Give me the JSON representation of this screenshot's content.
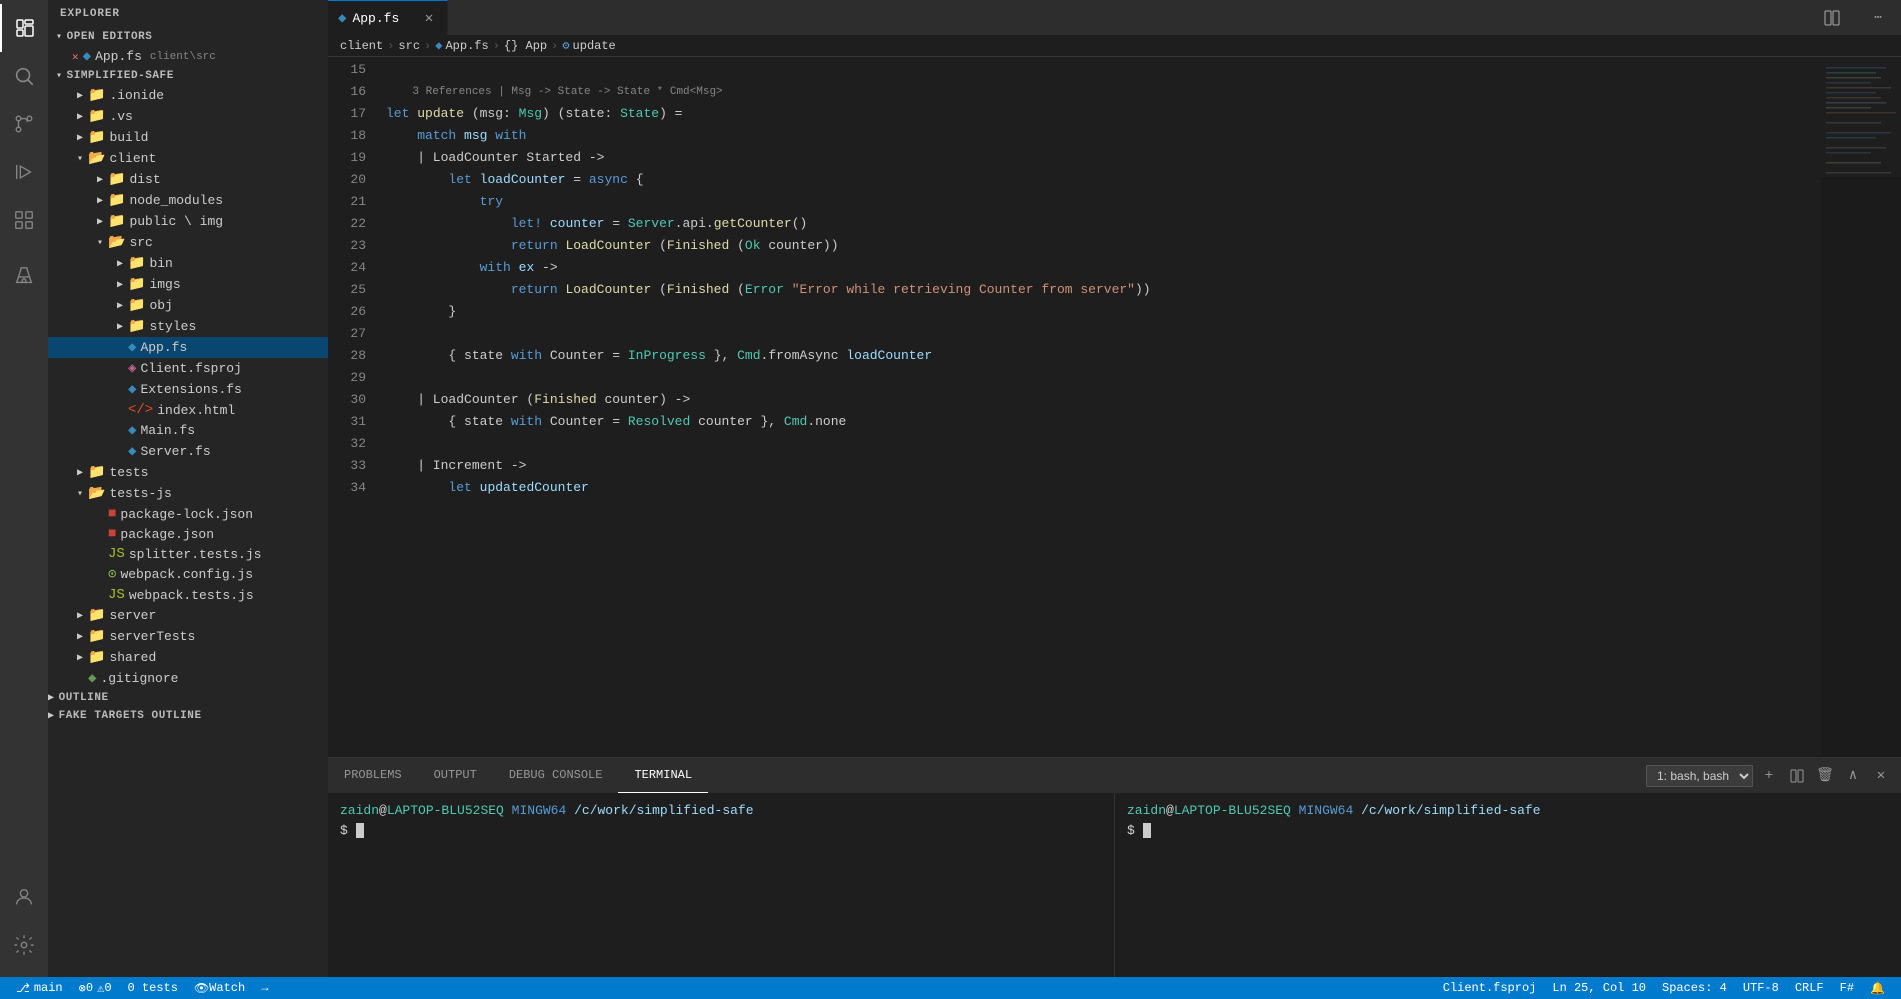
{
  "titlebar": {},
  "activityBar": {
    "icons": [
      {
        "name": "search-icon",
        "symbol": "⚲",
        "active": false
      },
      {
        "name": "explorer-icon",
        "symbol": "⧉",
        "active": true
      },
      {
        "name": "source-control-icon",
        "symbol": "⎇",
        "active": false
      },
      {
        "name": "run-icon",
        "symbol": "▷",
        "active": false
      },
      {
        "name": "extensions-icon",
        "symbol": "⊞",
        "active": false
      },
      {
        "name": "test-icon",
        "symbol": "⚗",
        "active": false
      },
      {
        "name": "remote-icon",
        "symbol": "≡",
        "active": false
      }
    ]
  },
  "sidebar": {
    "title": "EXPLORER",
    "sections": {
      "openEditors": {
        "label": "OPEN EDITORS",
        "items": [
          {
            "name": "App.fs",
            "path": "client\\src",
            "icon": "◆",
            "iconClass": "icon-fsharp",
            "modified": true
          }
        ]
      },
      "simplifiedSafe": {
        "label": "SIMPLIFIED-SAFE",
        "items": [
          {
            "indent": 1,
            "type": "folder",
            "name": ".ionide",
            "expanded": false
          },
          {
            "indent": 1,
            "type": "folder",
            "name": ".vs",
            "expanded": false
          },
          {
            "indent": 1,
            "type": "folder",
            "name": "build",
            "expanded": false
          },
          {
            "indent": 1,
            "type": "folder",
            "name": "client",
            "expanded": true
          },
          {
            "indent": 2,
            "type": "folder",
            "name": "dist",
            "expanded": false
          },
          {
            "indent": 2,
            "type": "folder",
            "name": "node_modules",
            "expanded": false
          },
          {
            "indent": 2,
            "type": "folder",
            "name": "public \\ img",
            "expanded": false
          },
          {
            "indent": 2,
            "type": "folder",
            "name": "src",
            "expanded": true
          },
          {
            "indent": 3,
            "type": "folder",
            "name": "bin",
            "expanded": false
          },
          {
            "indent": 3,
            "type": "folder",
            "name": "imgs",
            "expanded": false
          },
          {
            "indent": 3,
            "type": "folder",
            "name": "obj",
            "expanded": false
          },
          {
            "indent": 3,
            "type": "folder",
            "name": "styles",
            "expanded": false
          },
          {
            "indent": 3,
            "type": "file",
            "name": "App.fs",
            "icon": "◆",
            "iconClass": "icon-fsharp"
          },
          {
            "indent": 3,
            "type": "file",
            "name": "Client.fsproj",
            "icon": "◈",
            "iconClass": "icon-fsproj"
          },
          {
            "indent": 3,
            "type": "file",
            "name": "Extensions.fs",
            "icon": "◆",
            "iconClass": "icon-fsharp"
          },
          {
            "indent": 3,
            "type": "file",
            "name": "index.html",
            "icon": "◇",
            "iconClass": "icon-html"
          },
          {
            "indent": 3,
            "type": "file",
            "name": "Main.fs",
            "icon": "◆",
            "iconClass": "icon-fsharp"
          },
          {
            "indent": 3,
            "type": "file",
            "name": "Server.fs",
            "icon": "◆",
            "iconClass": "icon-fsharp"
          },
          {
            "indent": 1,
            "type": "folder",
            "name": "tests",
            "expanded": false
          },
          {
            "indent": 1,
            "type": "folder",
            "name": "tests-js",
            "expanded": false
          },
          {
            "indent": 2,
            "type": "file",
            "name": "package-lock.json",
            "icon": "■",
            "iconClass": "icon-json"
          },
          {
            "indent": 2,
            "type": "file",
            "name": "package.json",
            "icon": "■",
            "iconClass": "icon-json"
          },
          {
            "indent": 2,
            "type": "file",
            "name": "splitter.tests.js",
            "icon": "◉",
            "iconClass": "icon-js"
          },
          {
            "indent": 2,
            "type": "file",
            "name": "webpack.config.js",
            "icon": "◉",
            "iconClass": "icon-js"
          },
          {
            "indent": 2,
            "type": "file",
            "name": "webpack.tests.js",
            "icon": "◉",
            "iconClass": "icon-js"
          },
          {
            "indent": 1,
            "type": "folder",
            "name": "server",
            "expanded": false
          },
          {
            "indent": 1,
            "type": "folder",
            "name": "serverTests",
            "expanded": false
          },
          {
            "indent": 1,
            "type": "folder",
            "name": "shared",
            "expanded": false
          },
          {
            "indent": 1,
            "type": "file",
            "name": ".gitignore",
            "icon": "◆",
            "iconClass": "icon-fsharp"
          }
        ]
      }
    }
  },
  "tabs": [
    {
      "label": "App.fs",
      "active": true,
      "icon": "◆",
      "modified": false
    }
  ],
  "breadcrumb": [
    {
      "label": "client"
    },
    {
      "label": "src"
    },
    {
      "label": "App.fs",
      "icon": "◆"
    },
    {
      "label": "{} App"
    },
    {
      "label": "update",
      "icon": "⚙"
    }
  ],
  "codeLines": [
    {
      "num": 15,
      "content": ""
    },
    {
      "num": 16,
      "tokens": [
        {
          "text": "    ",
          "class": ""
        },
        {
          "text": "3 References",
          "class": "ref-hint"
        },
        {
          "text": " | Msg -> State -> State * Cmd<Msg>",
          "class": "ref-hint"
        }
      ]
    },
    {
      "num": 17,
      "tokens": [
        {
          "text": "let ",
          "class": "kw"
        },
        {
          "text": "update",
          "class": "fn"
        },
        {
          "text": " (msg: ",
          "class": "op"
        },
        {
          "text": "Msg",
          "class": "type"
        },
        {
          "text": ") (state: ",
          "class": "op"
        },
        {
          "text": "State",
          "class": "type"
        },
        {
          "text": ") =",
          "class": "op"
        }
      ]
    },
    {
      "num": 18,
      "tokens": [
        {
          "text": "    match ",
          "class": "kw"
        },
        {
          "text": "msg",
          "class": "var"
        },
        {
          "text": " with",
          "class": "kw"
        }
      ]
    },
    {
      "num": 19,
      "tokens": [
        {
          "text": "    | LoadCounter Started ->",
          "class": "op"
        }
      ]
    },
    {
      "num": 20,
      "tokens": [
        {
          "text": "        let ",
          "class": "kw"
        },
        {
          "text": "loadCounter",
          "class": "var"
        },
        {
          "text": " = ",
          "class": "op"
        },
        {
          "text": "async",
          "class": "kw"
        },
        {
          "text": " {",
          "class": "op"
        }
      ]
    },
    {
      "num": 21,
      "tokens": [
        {
          "text": "            try",
          "class": "kw"
        }
      ]
    },
    {
      "num": 22,
      "tokens": [
        {
          "text": "                let! ",
          "class": "kw"
        },
        {
          "text": "counter",
          "class": "var"
        },
        {
          "text": " = ",
          "class": "op"
        },
        {
          "text": "Server",
          "class": "type"
        },
        {
          "text": ".api.",
          "class": "op"
        },
        {
          "text": "getCounter",
          "class": "fn"
        },
        {
          "text": "()",
          "class": "op"
        }
      ]
    },
    {
      "num": 23,
      "tokens": [
        {
          "text": "                return ",
          "class": "kw"
        },
        {
          "text": "LoadCounter",
          "class": "fn"
        },
        {
          "text": " (",
          "class": "op"
        },
        {
          "text": "Finished",
          "class": "fn"
        },
        {
          "text": " (",
          "class": "op"
        },
        {
          "text": "Ok",
          "class": "type"
        },
        {
          "text": " counter))",
          "class": "op"
        }
      ]
    },
    {
      "num": 24,
      "tokens": [
        {
          "text": "            with ",
          "class": "kw"
        },
        {
          "text": "ex",
          "class": "var"
        },
        {
          "text": " ->",
          "class": "op"
        }
      ]
    },
    {
      "num": 25,
      "tokens": [
        {
          "text": "                return ",
          "class": "kw"
        },
        {
          "text": "LoadCounter",
          "class": "fn"
        },
        {
          "text": " (",
          "class": "op"
        },
        {
          "text": "Finished",
          "class": "fn"
        },
        {
          "text": " (",
          "class": "op"
        },
        {
          "text": "Error",
          "class": "type"
        },
        {
          "text": " \"Error while retrieving Counter from server\"))",
          "class": "str"
        }
      ]
    },
    {
      "num": 26,
      "tokens": [
        {
          "text": "        }",
          "class": "op"
        }
      ]
    },
    {
      "num": 27,
      "tokens": []
    },
    {
      "num": 28,
      "tokens": [
        {
          "text": "        { state ",
          "class": "op"
        },
        {
          "text": "with",
          "class": "kw"
        },
        {
          "text": " Counter = ",
          "class": "op"
        },
        {
          "text": "InProgress",
          "class": "type"
        },
        {
          "text": " }, ",
          "class": "op"
        },
        {
          "text": "Cmd",
          "class": "type"
        },
        {
          "text": ".fromAsync ",
          "class": "op"
        },
        {
          "text": "loadCounter",
          "class": "var"
        }
      ]
    },
    {
      "num": 29,
      "tokens": []
    },
    {
      "num": 30,
      "tokens": [
        {
          "text": "    | LoadCounter (",
          "class": "op"
        },
        {
          "text": "Finished",
          "class": "fn"
        },
        {
          "text": " counter) ->",
          "class": "op"
        }
      ]
    },
    {
      "num": 31,
      "tokens": [
        {
          "text": "        { state ",
          "class": "op"
        },
        {
          "text": "with",
          "class": "kw"
        },
        {
          "text": " Counter = ",
          "class": "op"
        },
        {
          "text": "Resolved",
          "class": "type"
        },
        {
          "text": " counter }, ",
          "class": "op"
        },
        {
          "text": "Cmd",
          "class": "type"
        },
        {
          "text": ".none",
          "class": "op"
        }
      ]
    },
    {
      "num": 32,
      "tokens": []
    },
    {
      "num": 33,
      "tokens": [
        {
          "text": "    | Increment ->",
          "class": "op"
        }
      ]
    },
    {
      "num": 34,
      "tokens": [
        {
          "text": "        let ",
          "class": "kw"
        },
        {
          "text": "updatedCounter",
          "class": "var"
        },
        {
          "text": "...",
          "class": "op"
        }
      ]
    }
  ],
  "panel": {
    "tabs": [
      {
        "label": "PROBLEMS",
        "active": false
      },
      {
        "label": "OUTPUT",
        "active": false
      },
      {
        "label": "DEBUG CONSOLE",
        "active": false
      },
      {
        "label": "TERMINAL",
        "active": true
      }
    ],
    "terminalSelector": "1: bash, bash",
    "terminals": [
      {
        "user": "zaidn",
        "host": "LAPTOP-BLU52SEQ",
        "pathLabel": "MINGW64",
        "path": "/c/work/simplified-safe",
        "prompt": "$",
        "cursor": true
      },
      {
        "user": "zaidn",
        "host": "LAPTOP-BLU52SEQ",
        "pathLabel": "MINGW64",
        "path": "/c/work/simplified-safe",
        "prompt": "$",
        "cursor": true
      }
    ]
  },
  "statusBar": {
    "left": [
      {
        "icon": "⎇",
        "label": "main"
      },
      {
        "icon": "⚠",
        "label": "0"
      },
      {
        "icon": "△",
        "label": "0"
      },
      {
        "icon": "👁",
        "label": "Watch"
      },
      {
        "icon": "→",
        "label": ""
      }
    ],
    "right": [
      {
        "label": "Client.fsproj"
      },
      {
        "label": "Ln 25, Col 10"
      },
      {
        "label": "Spaces: 4"
      },
      {
        "label": "UTF-8"
      },
      {
        "label": "CRLF"
      },
      {
        "label": "F#"
      },
      {
        "icon": "↑",
        "label": ""
      },
      {
        "icon": "⚡",
        "label": ""
      }
    ]
  },
  "outlineSection": {
    "label": "OUTLINE"
  },
  "fakeTargetsSection": {
    "label": "FAKE TARGETS OUTLINE"
  }
}
